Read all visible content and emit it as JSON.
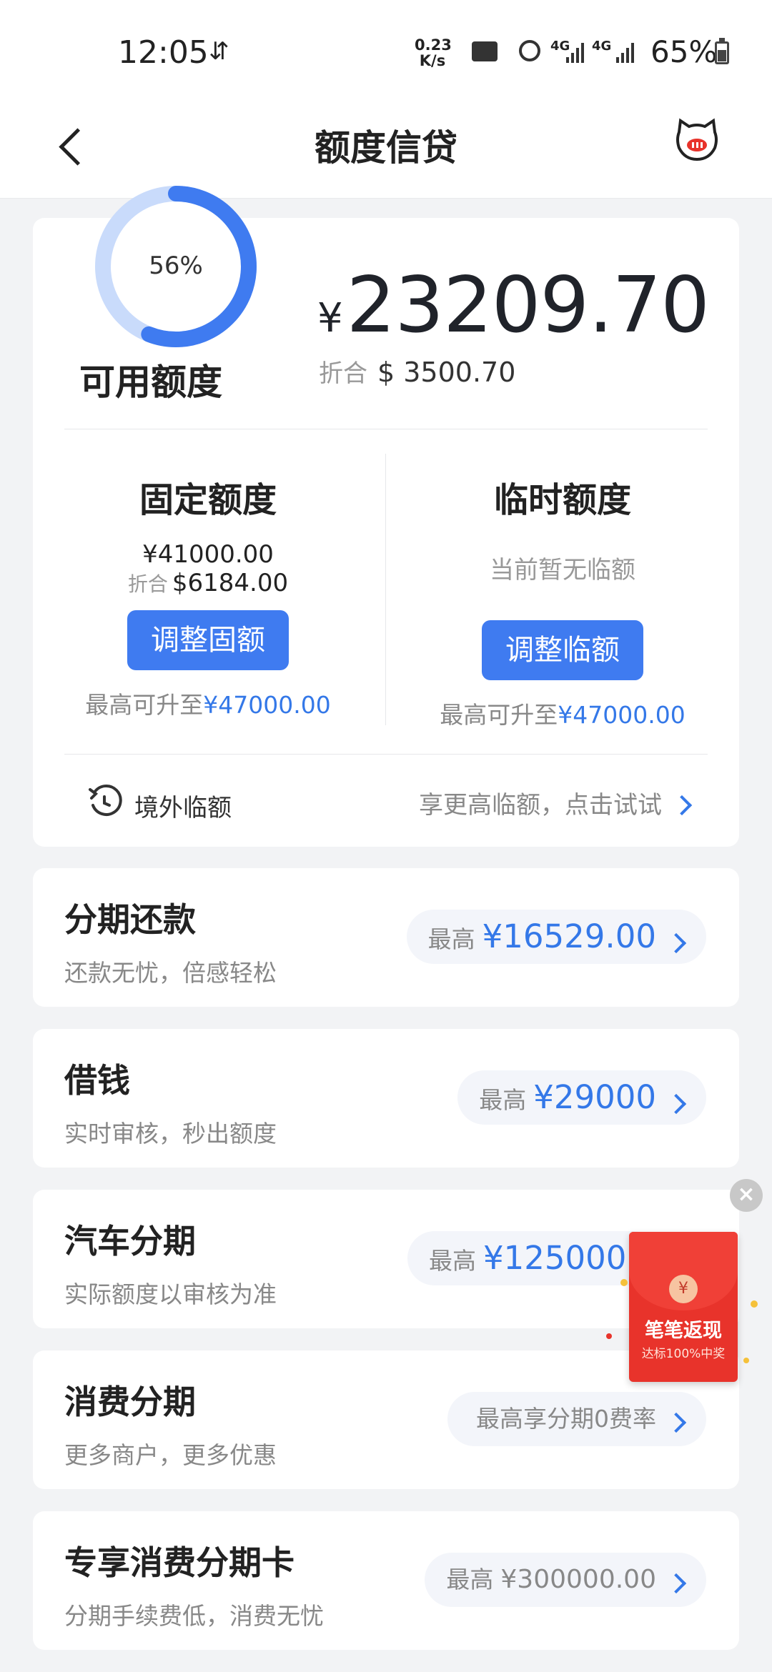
{
  "status_bar": {
    "time": "12:05",
    "speed_value": "0.23",
    "speed_unit": "K/s",
    "network_1": "4G",
    "network_2": "4G",
    "battery": "65%"
  },
  "nav": {
    "title": "额度信贷"
  },
  "credit": {
    "ring_percent": "56%",
    "ring_fraction": 0.56,
    "available_label": "可用额度",
    "currency_symbol": "¥",
    "available_amount": "23209.70",
    "usd_label": "折合",
    "usd_amount": "$ 3500.70",
    "fixed": {
      "title": "固定额度",
      "amount": "¥41000.00",
      "usd_label": "折合",
      "usd_amount": "$6184.00",
      "button": "调整固额",
      "max_prefix": "最高可升至",
      "max_value": "¥47000.00"
    },
    "temporary": {
      "title": "临时额度",
      "empty_text": "当前暂无临额",
      "button": "调整临额",
      "max_prefix": "最高可升至",
      "max_value": "¥47000.00"
    },
    "overseas": {
      "label": "境外临额",
      "hint": "享更高临额，点击试试"
    }
  },
  "products": [
    {
      "title": "分期还款",
      "desc": "还款无忧，倍感轻松",
      "pill_label": "最高",
      "pill_value": "¥16529.00"
    },
    {
      "title": "借钱",
      "desc": "实时审核，秒出额度",
      "pill_label": "最高",
      "pill_value": "¥29000"
    },
    {
      "title": "汽车分期",
      "desc": "实际额度以审核为准",
      "pill_label": "最高",
      "pill_value": "¥125000."
    },
    {
      "title": "消费分期",
      "desc": "更多商户，更多优惠",
      "pill_label": "",
      "pill_value": "最高享分期0费率"
    },
    {
      "title": "专享消费分期卡",
      "desc": "分期手续费低，消费无忧",
      "pill_label": "最高",
      "pill_value": "¥300000.00"
    }
  ],
  "promo": {
    "coin": "¥",
    "title": "笔笔返现",
    "subtitle": "达标100%中奖",
    "close": "×"
  },
  "colors": {
    "accent_blue": "#3f7bf0",
    "ring_light": "#c9dbfb",
    "red_packet": "#e8332b"
  }
}
